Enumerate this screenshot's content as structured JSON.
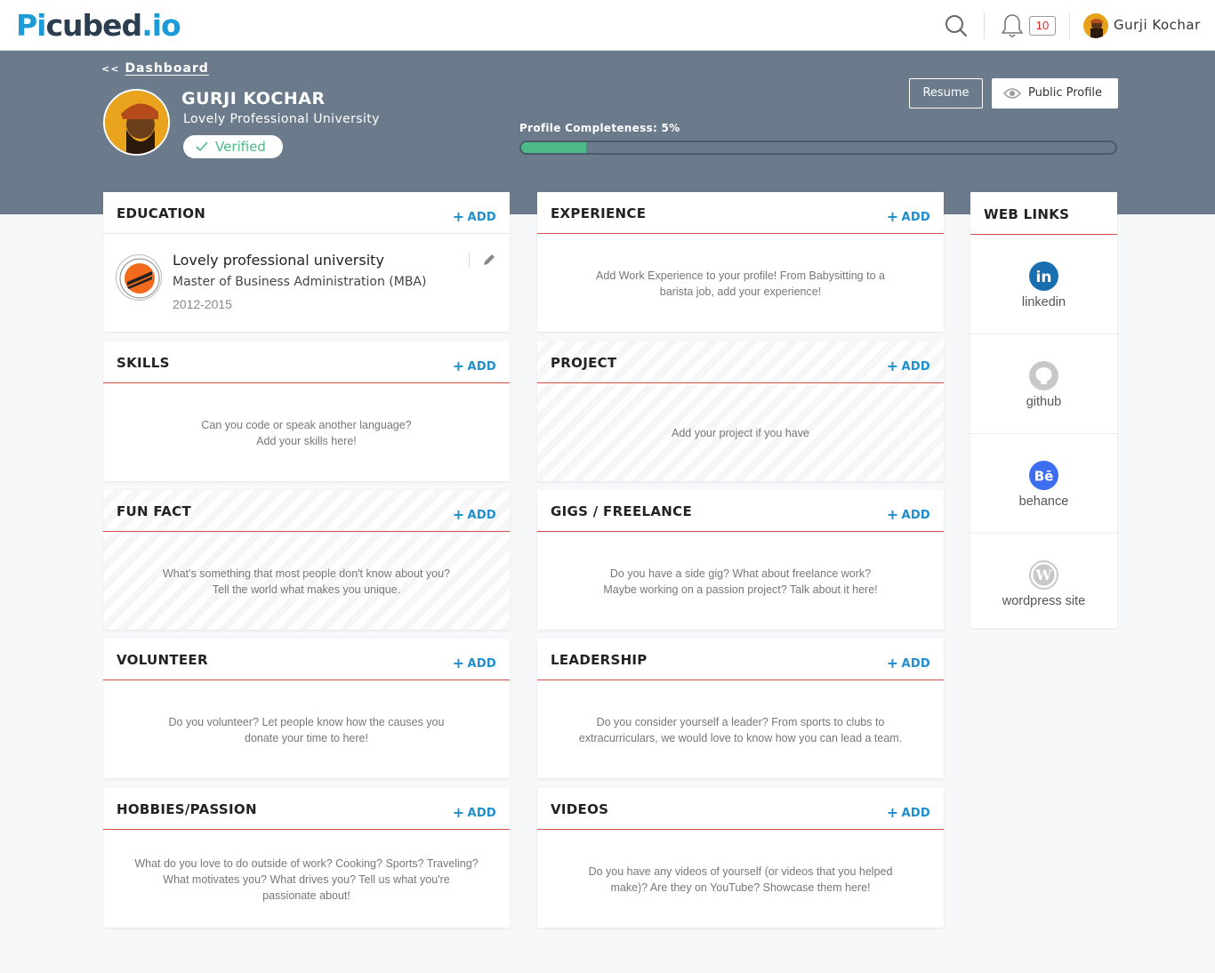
{
  "nav": {
    "logo_pi": "Pi",
    "logo_rest": "cubed",
    "logo_io": ".io",
    "notifications_count": "10",
    "username": "Gurji Kochar"
  },
  "hero": {
    "back_arrows": "<<",
    "back_label": "Dashboard",
    "name": "GURJI KOCHAR",
    "university": "Lovely Professional University",
    "verified_label": "Verified",
    "resume_label": "Resume",
    "public_profile_label": "Public Profile",
    "completeness_label": "Profile Completeness: 5%",
    "completeness_value": 5
  },
  "add_label": "ADD",
  "education": {
    "title": "EDUCATION",
    "school": "Lovely professional university",
    "degree": "Master of Business Administration (MBA)",
    "years": "2012-2015"
  },
  "sections": {
    "experience": {
      "title": "EXPERIENCE",
      "line1": "Add Work Experience to your profile! From Babysitting to a",
      "line2": "barista job, add your experience!"
    },
    "skills": {
      "title": "SKILLS",
      "line1": "Can you code or speak another language?",
      "line2": "Add your skills here!"
    },
    "project": {
      "title": "PROJECT",
      "line1": "Add your project if you have",
      "line2": ""
    },
    "funfact": {
      "title": "FUN FACT",
      "line1": "What's something that most people don't know about you?",
      "line2": "Tell the world what makes you unique."
    },
    "gigs": {
      "title": "GIGS / FREELANCE",
      "line1": "Do you have a side gig? What about freelance work?",
      "line2": "Maybe working on a passion project? Talk about it here!"
    },
    "volunteer": {
      "title": "VOLUNTEER",
      "line1": "Do you volunteer? Let people know how the causes you",
      "line2": "donate your time to here!"
    },
    "leadership": {
      "title": "LEADERSHIP",
      "line1": "Do you consider yourself a leader? From sports to clubs to",
      "line2": "extracurriculars, we would love to know how you can lead a team."
    },
    "hobbies": {
      "title": "HOBBIES/PASSION",
      "line1": "What do you love to do outside of work? Cooking? Sports? Traveling?",
      "line2": "What motivates you? What drives you? Tell us what you're",
      "line3": "passionate about!"
    },
    "videos": {
      "title": "VIDEOS",
      "line1": "Do you have any videos of yourself (or videos that you helped",
      "line2": "make)? Are they on YouTube? Showcase them here!"
    }
  },
  "weblinks": {
    "title": "WEB LINKS",
    "items": [
      {
        "label": "linkedin",
        "icon": "linkedin-icon"
      },
      {
        "label": "github",
        "icon": "github-icon"
      },
      {
        "label": "behance",
        "icon": "behance-icon"
      },
      {
        "label": "wordpress site",
        "icon": "wordpress-icon"
      }
    ]
  },
  "colors": {
    "brand_blue": "#1c9bd6",
    "hero_bg": "#6b7b8c",
    "accent_red": "#d24b4b",
    "success_green": "#4dba87",
    "linkedin": "#1a6fb0",
    "behance": "#3d6ef0"
  }
}
